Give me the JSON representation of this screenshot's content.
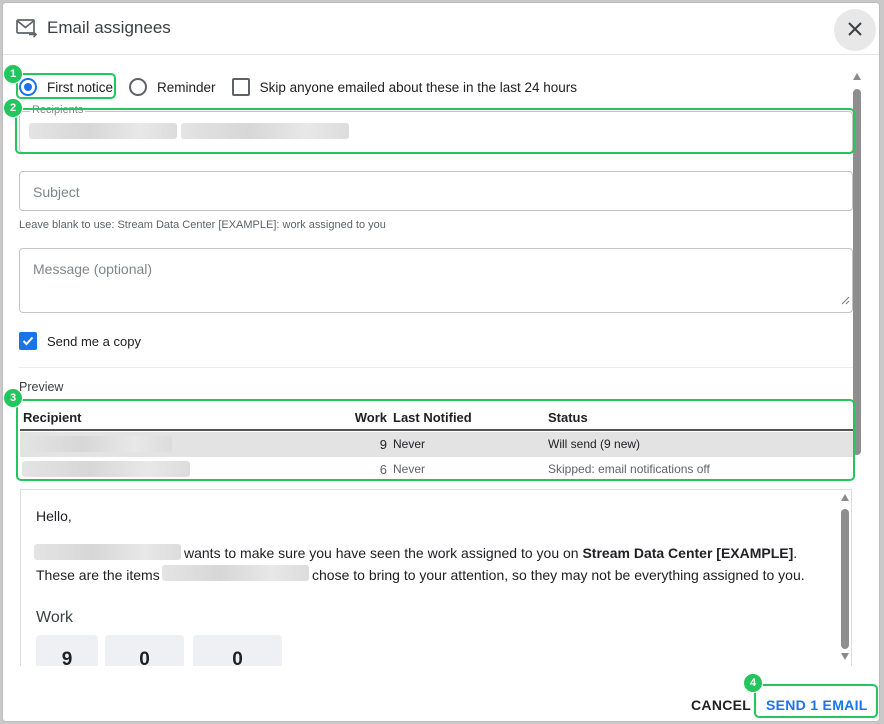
{
  "dialog": {
    "title": "Email assignees",
    "close_icon": "close-icon",
    "mail_icon": "mail-forward-icon"
  },
  "options": {
    "first_notice": "First notice",
    "reminder": "Reminder",
    "skip_recent": "Skip anyone emailed about these in the last 24 hours",
    "selected": "First notice",
    "skip_recent_checked": false
  },
  "recipients": {
    "label": "Recipients"
  },
  "subject": {
    "placeholder": "Subject",
    "hint": "Leave blank to use: Stream Data Center [EXAMPLE]: work assigned to you"
  },
  "message": {
    "placeholder": "Message (optional)"
  },
  "send_copy": {
    "label": "Send me a copy",
    "checked": true
  },
  "preview": {
    "label": "Preview",
    "columns": [
      "Recipient",
      "Work",
      "Last Notified",
      "Status"
    ],
    "rows": [
      {
        "work": "9",
        "last_notified": "Never",
        "status": "Will send (9 new)"
      },
      {
        "work": "6",
        "last_notified": "Never",
        "status": "Skipped: email notifications off"
      }
    ]
  },
  "email_body": {
    "greeting": "Hello,",
    "line1_part1": "wants to make sure you have seen the work assigned to you on",
    "line1_bold": "Stream Data Center [EXAMPLE]",
    "line1_end": ".",
    "line2_part1": "These are the items",
    "line2_part2": "chose to bring to your attention, so they may not be everything assigned to you.",
    "work_heading": "Work",
    "work_counts": [
      "9",
      "0",
      "0"
    ]
  },
  "footer": {
    "cancel": "CANCEL",
    "send": "SEND 1 EMAIL"
  },
  "annotations": [
    "1",
    "2",
    "3",
    "4"
  ],
  "colors": {
    "accent": "#1a73e8",
    "highlight": "#22c55e"
  }
}
